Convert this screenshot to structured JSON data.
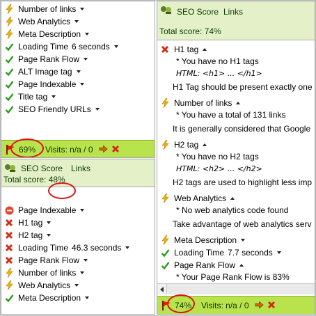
{
  "top_left": {
    "items": [
      {
        "label": "Number of links",
        "value": "",
        "icon": "bolt-icon",
        "arrow": "down"
      },
      {
        "label": "Web Analytics",
        "value": "",
        "icon": "bolt-icon",
        "arrow": "down"
      },
      {
        "label": "Meta Description",
        "value": "",
        "icon": "bolt-icon",
        "arrow": "down"
      },
      {
        "label": "Loading Time",
        "value": "6 seconds",
        "icon": "check-icon",
        "arrow": "down"
      },
      {
        "label": "Page Rank Flow",
        "value": "",
        "icon": "check-icon",
        "arrow": "down"
      },
      {
        "label": "ALT Image tag",
        "value": "",
        "icon": "check-icon",
        "arrow": "down"
      },
      {
        "label": "Page Indexable",
        "value": "",
        "icon": "check-icon",
        "arrow": "down"
      },
      {
        "label": "Title tag",
        "value": "",
        "icon": "check-icon",
        "arrow": "down"
      },
      {
        "label": "SEO Friendly URLs",
        "value": "",
        "icon": "check-icon",
        "arrow": "down"
      }
    ],
    "status": {
      "percent": "69%",
      "visits": "Visits: n/a / 0"
    }
  },
  "bottom_left": {
    "header": {
      "title": "SEO Score",
      "links": "Links",
      "total_label": "Total score:",
      "total_value": "48%"
    },
    "items": [
      {
        "label": "Page Indexable",
        "value": "",
        "icon": "no-entry-icon",
        "arrow": "down"
      },
      {
        "label": "H1 tag",
        "value": "",
        "icon": "cross-icon",
        "arrow": "down"
      },
      {
        "label": "H2 tag",
        "value": "",
        "icon": "cross-icon",
        "arrow": "down"
      },
      {
        "label": "Loading Time",
        "value": "46.3 seconds",
        "icon": "cross-icon",
        "arrow": "down"
      },
      {
        "label": "Page Rank Flow",
        "value": "",
        "icon": "cross-icon",
        "arrow": "down"
      },
      {
        "label": "Number of links",
        "value": "",
        "icon": "bolt-icon",
        "arrow": "down"
      },
      {
        "label": "Web Analytics",
        "value": "",
        "icon": "bolt-icon",
        "arrow": "down"
      },
      {
        "label": "Meta Description",
        "value": "",
        "icon": "check-icon",
        "arrow": "down"
      }
    ]
  },
  "right": {
    "header": {
      "title": "SEO Score",
      "links": "Links",
      "total_label": "Total score:",
      "total_value": "74%"
    },
    "sections": [
      {
        "label": "H1 tag",
        "icon": "cross-icon",
        "arrow": "up",
        "lines": [
          "* You have no H1 tags",
          "HTML: <h1> ... </h1>",
          "H1 Tag should be present exactly one"
        ]
      },
      {
        "label": "Number of links",
        "icon": "bolt-icon",
        "arrow": "up",
        "lines": [
          "* You have a total of 131 links",
          "It is generally considered that Google"
        ]
      },
      {
        "label": "H2 tag",
        "icon": "bolt-icon",
        "arrow": "up",
        "lines": [
          "* You have no H2 tags",
          "HTML: <h2> ... </h2>",
          "H2 tags are used to highlight less imp"
        ]
      },
      {
        "label": "Web Analytics",
        "icon": "bolt-icon",
        "arrow": "up",
        "lines": [
          "* No web analytics code found",
          "Take advantage of web analytics serv"
        ]
      },
      {
        "label": "Meta Description",
        "icon": "bolt-icon",
        "arrow": "down",
        "lines": []
      },
      {
        "label": "Loading Time",
        "value": "7.7 seconds",
        "icon": "check-icon",
        "arrow": "down",
        "lines": []
      },
      {
        "label": "Page Rank Flow",
        "icon": "check-icon",
        "arrow": "up",
        "lines": [
          "* Your Page Rank Flow is 83%"
        ]
      }
    ],
    "status": {
      "percent": "74%",
      "visits": "Visits: n/a / 0"
    }
  },
  "colors": {
    "status_green": "#b8e34d",
    "header_green": "#e3f0c8",
    "highlight_red": "#e01010"
  }
}
